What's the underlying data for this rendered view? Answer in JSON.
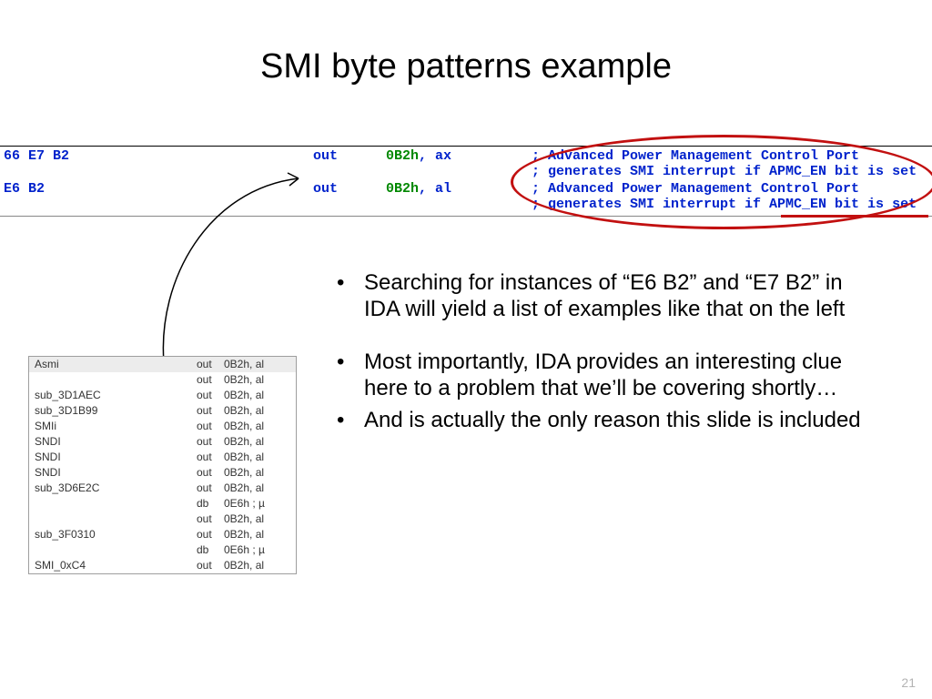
{
  "title": "SMI byte patterns example",
  "disasm": {
    "r1": {
      "bytes": "66 E7 B2",
      "mnem": "out",
      "op_port": "0B2h",
      "op_reg": ", ax",
      "cmt1": "; Advanced Power Management Control Port",
      "cmt2": "; generates SMI interrupt if APMC_EN bit is set"
    },
    "r2": {
      "bytes": "E6 B2",
      "mnem": "out",
      "op_port": "0B2h",
      "op_reg": ", al",
      "cmt1": "; Advanced Power Management Control Port",
      "cmt2": "; generates SMI interrupt if APMC_EN bit is set"
    }
  },
  "table": {
    "rows": [
      {
        "name": "Asmi",
        "mnem": "out",
        "op": "0B2h, al"
      },
      {
        "name": "",
        "mnem": "out",
        "op": "0B2h, al"
      },
      {
        "name": "sub_3D1AEC",
        "mnem": "out",
        "op": "0B2h, al"
      },
      {
        "name": "sub_3D1B99",
        "mnem": "out",
        "op": "0B2h, al"
      },
      {
        "name": "SMIi",
        "mnem": "out",
        "op": "0B2h, al"
      },
      {
        "name": "SNDI",
        "mnem": "out",
        "op": "0B2h, al"
      },
      {
        "name": "SNDI",
        "mnem": "out",
        "op": "0B2h, al"
      },
      {
        "name": "SNDI",
        "mnem": "out",
        "op": "0B2h, al"
      },
      {
        "name": "sub_3D6E2C",
        "mnem": "out",
        "op": "0B2h, al"
      },
      {
        "name": "",
        "mnem": "db",
        "op": "0E6h ; µ"
      },
      {
        "name": "",
        "mnem": "out",
        "op": "0B2h, al"
      },
      {
        "name": "sub_3F0310",
        "mnem": "out",
        "op": "0B2h, al"
      },
      {
        "name": "",
        "mnem": "db",
        "op": "0E6h ; µ"
      },
      {
        "name": "SMI_0xC4",
        "mnem": "out",
        "op": "0B2h, al"
      }
    ]
  },
  "bullets": {
    "b1": "Searching for instances of “E6 B2” and “E7 B2” in IDA will yield a list of examples like that on the left",
    "b2": "Most importantly, IDA provides an interesting clue here to a problem that we’ll be covering shortly…",
    "b3": "And is actually the only reason this slide is included"
  },
  "pagenum": "21"
}
